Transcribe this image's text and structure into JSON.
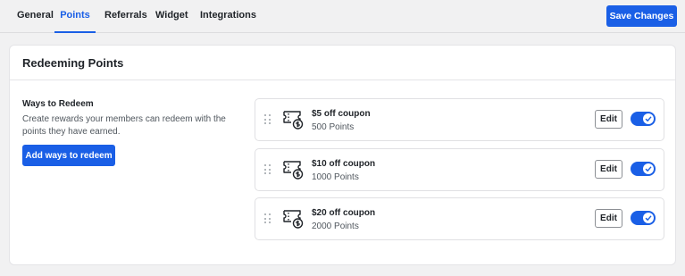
{
  "tabs": [
    {
      "label": "General",
      "active": false
    },
    {
      "label": "Points",
      "active": true
    },
    {
      "label": "Referrals",
      "active": false
    },
    {
      "label": "Widget",
      "active": false
    },
    {
      "label": "Integrations",
      "active": false
    }
  ],
  "header": {
    "save_label": "Save Changes"
  },
  "accent_color": "#1a5fe6",
  "section": {
    "title": "Redeeming Points",
    "ways_title": "Ways to Redeem",
    "ways_description": "Create rewards your members can redeem with the points they have earned.",
    "add_button_label": "Add ways to redeem"
  },
  "rewards": [
    {
      "name": "$5 off coupon",
      "points": "500 Points",
      "edit_label": "Edit",
      "enabled": true,
      "icon": "coupon-icon"
    },
    {
      "name": "$10 off coupon",
      "points": "1000 Points",
      "edit_label": "Edit",
      "enabled": true,
      "icon": "coupon-icon"
    },
    {
      "name": "$20 off coupon",
      "points": "2000 Points",
      "edit_label": "Edit",
      "enabled": true,
      "icon": "coupon-icon"
    }
  ]
}
